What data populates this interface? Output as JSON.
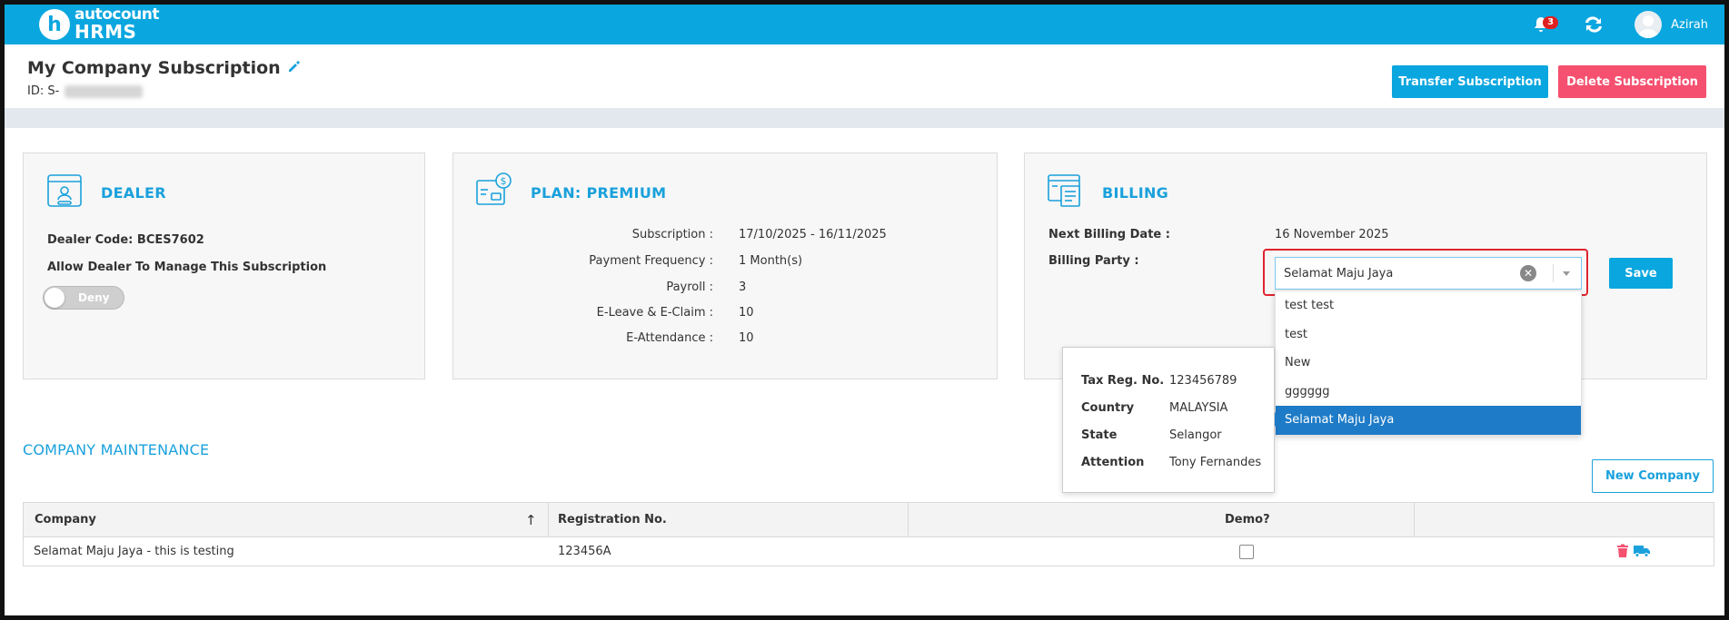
{
  "app": {
    "logo_letter": "h",
    "logo_top": "autocount",
    "logo_bottom": "HRMS",
    "notification_count": "3",
    "user_name": "Azirah"
  },
  "header": {
    "title": "My Company Subscription",
    "id_prefix": "ID: S-",
    "transfer_label": "Transfer Subscription",
    "delete_label": "Delete Subscription"
  },
  "dealer": {
    "title": "DEALER",
    "dealer_code": "Dealer Code: BCES7602",
    "allow_label": "Allow Dealer To Manage This Subscription",
    "toggle_label": "Deny"
  },
  "plan": {
    "title": "PLAN: PREMIUM",
    "rows": [
      {
        "label": "Subscription :",
        "value": "17/10/2025 - 16/11/2025"
      },
      {
        "label": "Payment Frequency :",
        "value": "1 Month(s)"
      },
      {
        "label": "Payroll :",
        "value": "3"
      },
      {
        "label": "E-Leave & E-Claim :",
        "value": "10"
      },
      {
        "label": "E-Attendance :",
        "value": "10"
      }
    ]
  },
  "billing": {
    "title": "BILLING",
    "next_billing_label": "Next Billing Date :",
    "next_billing_value": "16 November 2025",
    "billing_party_label": "Billing Party :",
    "billing_party_value": "Selamat Maju Jaya",
    "save_label": "Save",
    "options": [
      "test test",
      "test",
      "New",
      "gggggg",
      "Selamat Maju Jaya"
    ],
    "selected_index": 4,
    "tooltip": [
      {
        "label": "Tax Reg. No.",
        "value": "123456789"
      },
      {
        "label": "Country",
        "value": "MALAYSIA"
      },
      {
        "label": "State",
        "value": "Selangor"
      },
      {
        "label": "Attention",
        "value": "Tony Fernandes"
      }
    ]
  },
  "company": {
    "title": "COMPANY MAINTENANCE",
    "new_label": "New Company",
    "columns": [
      "Company",
      "Registration No.",
      "Demo?"
    ],
    "sort_indicator": "↑",
    "rows": [
      {
        "company": "Selamat Maju Jaya - this is testing",
        "registration": "123456A",
        "demo": false
      }
    ]
  },
  "colors": {
    "primary": "#0aa6df",
    "danger": "#f5506f",
    "selected": "#1e7bc7",
    "highlight": "#e0242f"
  }
}
